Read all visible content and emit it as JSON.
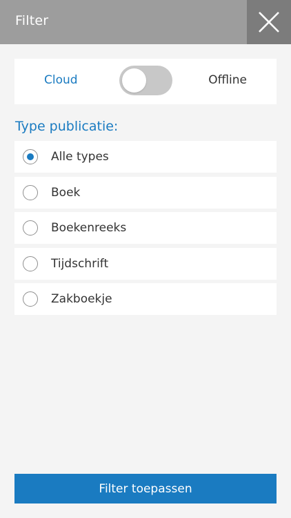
{
  "header": {
    "title": "Filter",
    "close_icon": "close-icon"
  },
  "source_toggle": {
    "left_label": "Cloud",
    "right_label": "Offline",
    "state": "off"
  },
  "publication_type": {
    "title": "Type publicatie:",
    "selected": "Alle types",
    "options": [
      {
        "label": "Alle types",
        "checked": true
      },
      {
        "label": "Boek",
        "checked": false
      },
      {
        "label": "Boekenreeks",
        "checked": false
      },
      {
        "label": "Tijdschrift",
        "checked": false
      },
      {
        "label": "Zakboekje",
        "checked": false
      }
    ]
  },
  "apply_button": {
    "label": "Filter toepassen"
  },
  "colors": {
    "accent": "#1a7bc1",
    "header_bg": "#9d9d9d",
    "close_bg": "#7c7c7c",
    "page_bg": "#f4f4f4"
  }
}
